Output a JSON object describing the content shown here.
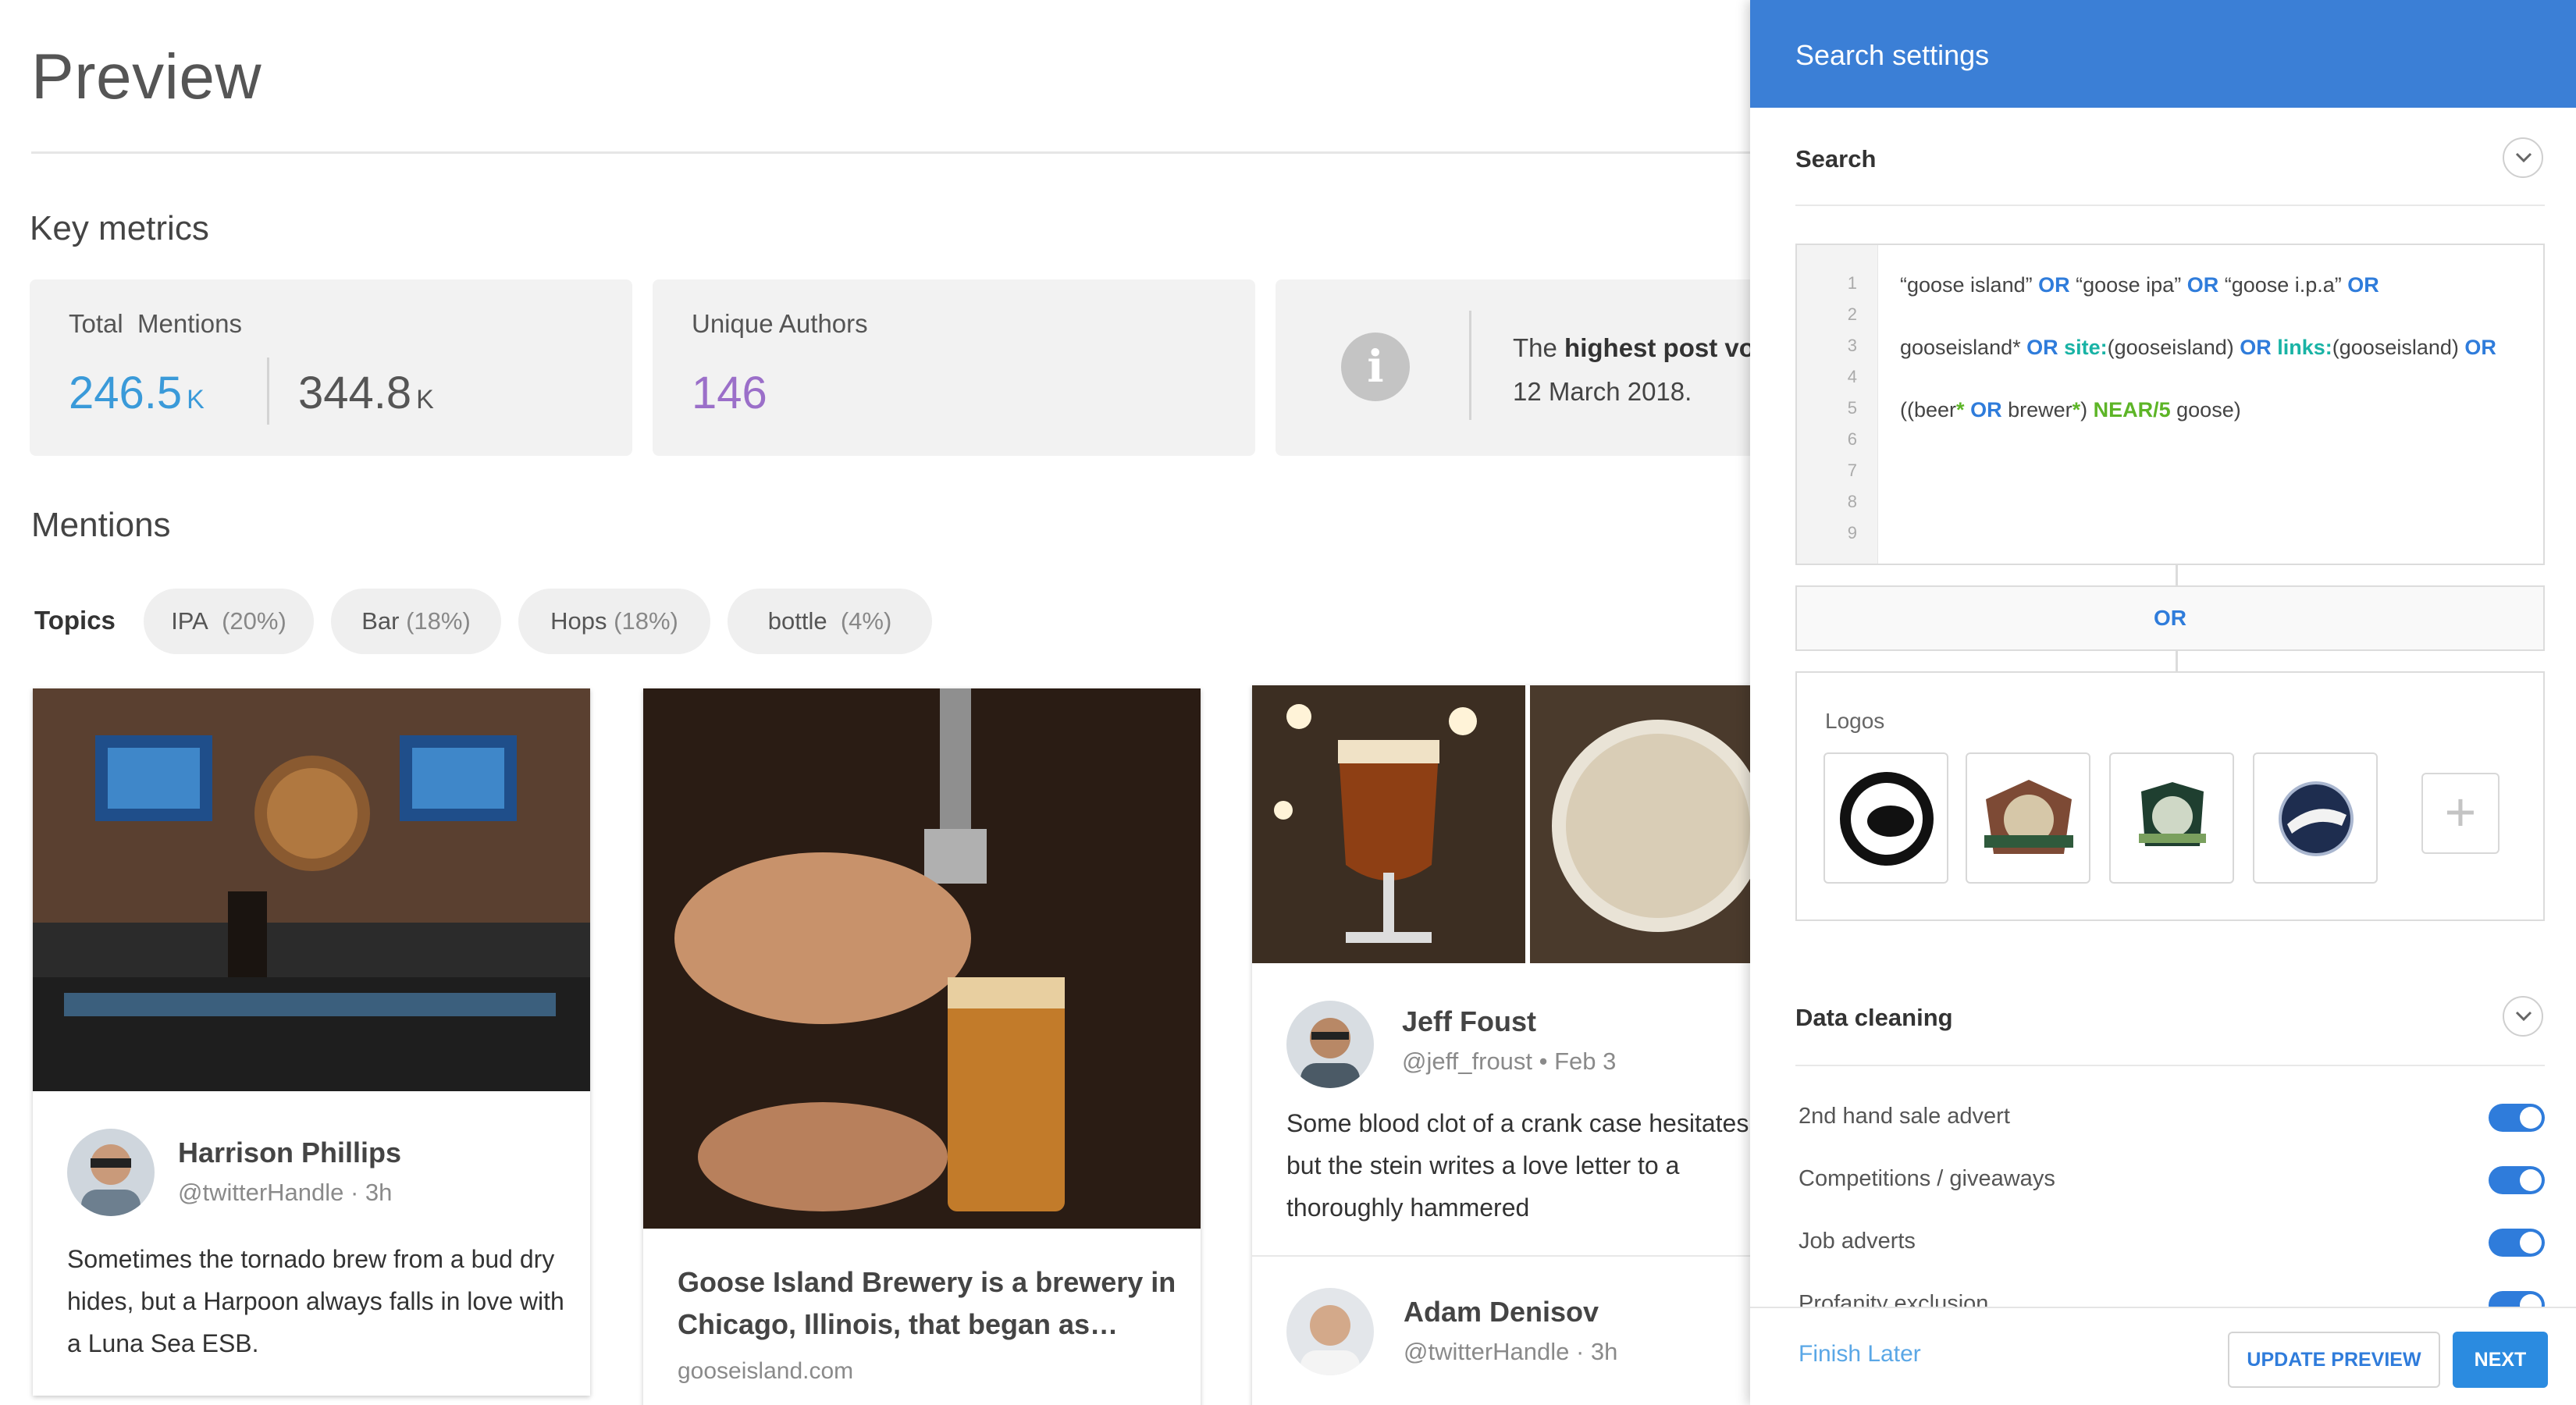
{
  "page": {
    "title": "Preview"
  },
  "key_metrics": {
    "heading": "Key metrics",
    "total_mentions": {
      "label": "Total  Mentions",
      "value_a": "246.5",
      "unit_a": "K",
      "value_b": "344.8",
      "unit_b": "K"
    },
    "unique_authors": {
      "label": "Unique Authors",
      "value": "146"
    },
    "highlight": {
      "prefix": "The ",
      "bold": "highest post vo",
      "date": "12 March 2018."
    }
  },
  "mentions": {
    "heading": "Mentions",
    "topics_label": "Topics",
    "topics": [
      {
        "name": "IPA",
        "pct": "(20%)"
      },
      {
        "name": "Bar",
        "pct": "(18%)"
      },
      {
        "name": "Hops",
        "pct": "(18%)"
      },
      {
        "name": "bottle",
        "pct": "(4%)"
      }
    ],
    "posts": [
      {
        "author": "Harrison Phillips",
        "handle": "@twitterHandle · 3h",
        "text": "Sometimes the tornado brew from a bud dry hides, but a Harpoon always falls in love with a Luna Sea ESB."
      },
      {
        "title": "Goose Island Brewery is a brewery in Chicago, Illinois, that began as…",
        "domain": "gooseisland.com"
      },
      {
        "author": "Jeff Foust",
        "handle": "@jeff_froust • Feb 3",
        "text": "Some blood clot of a crank case hesitates but the stein writes a love letter to a thoroughly hammered"
      },
      {
        "author": "Adam Denisov",
        "handle": "@twitterHandle · 3h"
      }
    ]
  },
  "panel": {
    "title": "Search settings",
    "search_section": "Search",
    "line_numbers": [
      "1",
      "2",
      "3",
      "4",
      "5",
      "6",
      "7",
      "8",
      "9"
    ],
    "query": {
      "line1": {
        "t1": "“goose island” ",
        "or1": "OR",
        "t2": " “goose ipa” ",
        "or2": "OR",
        "t3": " “goose i.p.a” ",
        "or3": "OR"
      },
      "line3": {
        "t1": "gooseisland* ",
        "or1": "OR",
        "site": " site:",
        "t2": "(gooseisland) ",
        "or2": "OR",
        "links": " links:",
        "t3": "(gooseisland) ",
        "or3": "OR"
      },
      "line5": {
        "t1": "((beer",
        "star": "*",
        "sp": " ",
        "or1": "OR",
        "t2": " brewer",
        "star2": "*",
        "t3": ") ",
        "near": "NEAR/5",
        "t4": " goose)"
      }
    },
    "or_label": "OR",
    "logos_label": "Logos",
    "add_logo": "+",
    "data_cleaning": "Data cleaning",
    "toggles": [
      {
        "label": "2nd hand sale advert",
        "on": true
      },
      {
        "label": "Competitions / giveaways",
        "on": true
      },
      {
        "label": "Job adverts",
        "on": true
      },
      {
        "label": "Profanity exclusion",
        "on": true
      }
    ],
    "footer": {
      "finish_later": "Finish Later",
      "update_preview": "UPDATE PREVIEW",
      "next": "NEXT"
    }
  },
  "colors": {
    "accent_blue": "#3b7fd6",
    "metric_blue": "#3a9ad9",
    "metric_purple": "#9b6fc9",
    "keyword_teal": "#19b3a5",
    "keyword_green": "#5db527"
  }
}
